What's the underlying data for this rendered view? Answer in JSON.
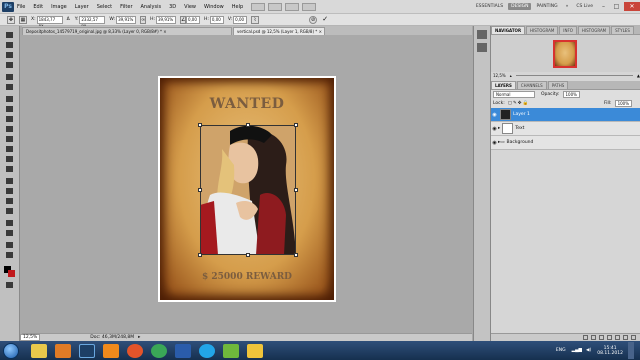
{
  "app": {
    "logo_text": "Ps",
    "menu": [
      "File",
      "Edit",
      "Image",
      "Layer",
      "Select",
      "Filter",
      "Analysis",
      "3D",
      "View",
      "Window",
      "Help"
    ],
    "workspace": {
      "buttons": [
        "ESSENTIALS",
        "DESIGN",
        "PAINTING"
      ],
      "active": "DESIGN",
      "more": "»",
      "cs_live": "CS Live"
    }
  },
  "options": {
    "x": {
      "label": "X:",
      "value": "1843,77 px"
    },
    "y": {
      "label": "Y:",
      "value": "2332,57 px"
    },
    "w": {
      "label": "W:",
      "value": "39,91%"
    },
    "h": {
      "label": "H:",
      "value": "39,91%"
    },
    "angle": {
      "label": "",
      "value": "0,00"
    },
    "hskew": {
      "label": "H:",
      "value": "0,00"
    },
    "vskew": {
      "label": "V:",
      "value": "0,00"
    }
  },
  "tabs": [
    {
      "label": "Depositphotos_14579719_original.jpg @ 8,33% (Layer 0, RGB/8#) *",
      "close": "×"
    },
    {
      "label": "vertical.psd @ 12,5% (Layer 1, RGB/8) *",
      "close": "×",
      "active": true
    }
  ],
  "poster": {
    "title": "WANTED",
    "reward": "$ 25000 REWARD"
  },
  "status": {
    "zoom": "12,5%",
    "doc": "Doc: 46,3M/248,8M"
  },
  "navigator": {
    "tabs": [
      "NAVIGATOR",
      "HISTOGRAM",
      "INFO",
      "HISTOGRAM",
      "STYLES"
    ],
    "zoom": "12,5%"
  },
  "layers": {
    "tabs": [
      "LAYERS",
      "CHANNELS",
      "PATHS"
    ],
    "blend_mode": "Normal",
    "opacity_label": "Opacity:",
    "opacity": "100%",
    "lock_label": "Lock:",
    "fill_label": "Fill:",
    "fill": "100%",
    "items": [
      {
        "name": "Layer 1",
        "selected": true
      },
      {
        "name": "Text",
        "selected": false
      },
      {
        "name": "Background",
        "selected": false
      }
    ]
  },
  "taskbar": {
    "lang": "ENG",
    "time": "15:41",
    "date": "08.11.2012",
    "icons": [
      "explorer-icon",
      "media-player-icon",
      "photoshop-icon",
      "vlc-icon",
      "firefox-icon",
      "chrome-icon",
      "word-icon",
      "skype-icon",
      "utorrent-icon",
      "folder-icon"
    ]
  },
  "colors": {
    "accent": "#3b8ad8",
    "close": "#c9453a"
  }
}
